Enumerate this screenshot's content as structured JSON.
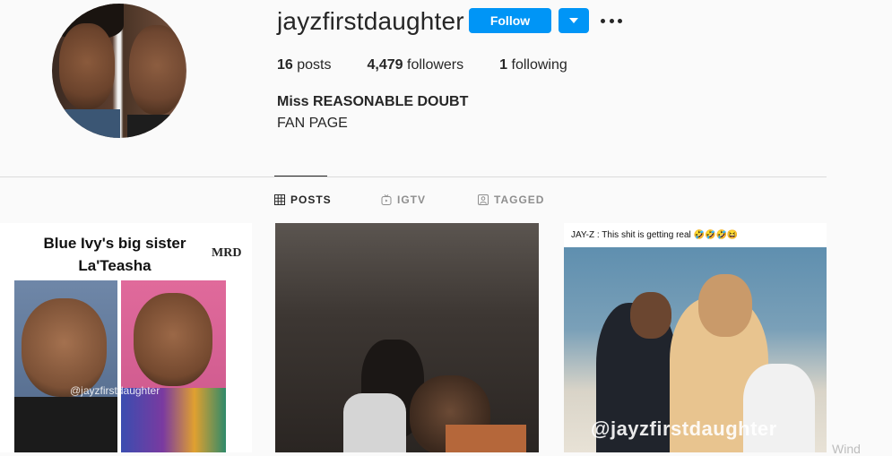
{
  "profile": {
    "username": "jayzfirstdaughter",
    "follow_label": "Follow",
    "stats": {
      "posts_count": "16",
      "posts_label": "posts",
      "followers_count": "4,479",
      "followers_label": "followers",
      "following_count": "1",
      "following_label": "following"
    },
    "full_name": "Miss REASONABLE DOUBT",
    "bio": "FAN PAGE"
  },
  "tabs": [
    {
      "label": "POSTS",
      "icon": "grid-icon",
      "active": true
    },
    {
      "label": "IGTV",
      "icon": "igtv-icon",
      "active": false
    },
    {
      "label": "TAGGED",
      "icon": "tagged-icon",
      "active": false
    }
  ],
  "posts": [
    {
      "title_line1": "Blue Ivy's big sister",
      "title_line2": "La'Teasha",
      "brand": "MRD",
      "watermark": "@jayzfirstdaughter"
    },
    {},
    {
      "caption": "JAY-Z : This shit is getting real 🤣🤣🤣😆",
      "watermark": "@jayzfirstdaughter"
    }
  ],
  "os_overlay": "Wind",
  "colors": {
    "follow_button": "#0095f6",
    "background": "#fafafa",
    "text": "#262626",
    "muted": "#8e8e8e"
  }
}
